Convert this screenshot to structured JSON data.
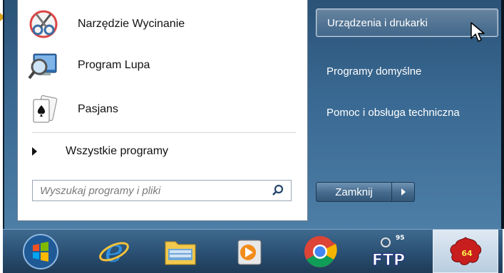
{
  "start_menu": {
    "programs": [
      {
        "label": "Narzędzie Wycinanie",
        "icon": "scissors-icon"
      },
      {
        "label": "Program Lupa",
        "icon": "magnifier-icon"
      },
      {
        "label": "Pasjans",
        "icon": "playing-cards-icon"
      }
    ],
    "all_programs_label": "Wszystkie programy",
    "search": {
      "placeholder": "Wyszukaj programy i pliki",
      "icon": "search-icon"
    },
    "right_items": [
      {
        "label": "Urządzenia i drukarki",
        "highlighted": true
      },
      {
        "label": "Programy domyślne",
        "highlighted": false
      },
      {
        "label": "Pomoc i obsługa techniczna",
        "highlighted": false
      }
    ],
    "shutdown_label": "Zamknij"
  },
  "taskbar": {
    "items": [
      {
        "icon": "windows-start-orb-icon"
      },
      {
        "icon": "internet-explorer-icon"
      },
      {
        "icon": "file-explorer-icon"
      },
      {
        "icon": "media-player-icon"
      },
      {
        "icon": "chrome-icon"
      },
      {
        "icon": "ftp-client-icon",
        "badge": "95"
      },
      {
        "icon": "game-app-icon",
        "badge": "64",
        "active": true
      }
    ]
  },
  "colors": {
    "menu_right": "#3a6a93",
    "taskbar": "#2a4f72",
    "accent_orange": "#d9a11a"
  }
}
